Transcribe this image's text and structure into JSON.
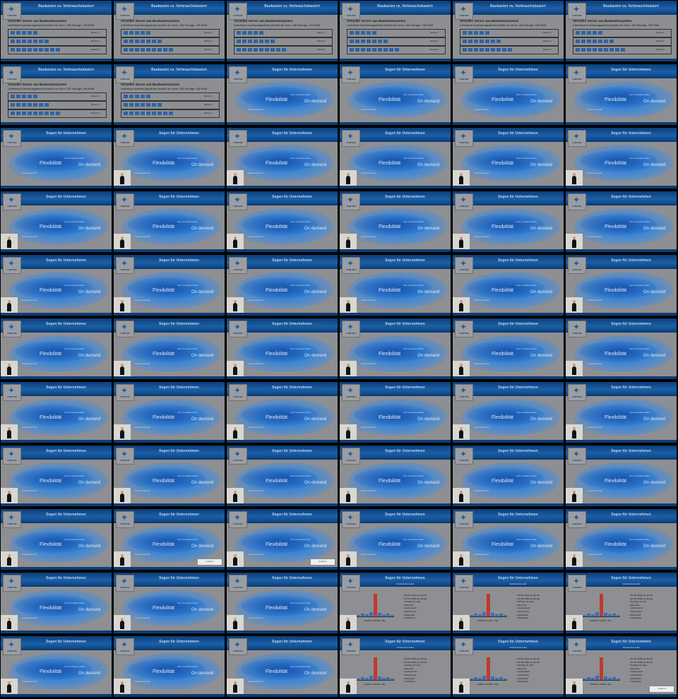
{
  "sheet": {
    "columns": 6,
    "rows": 11,
    "frame_count": 66
  },
  "slides": {
    "server": {
      "title": "Baukasten vs. Verbrauchsbasiert",
      "heading": "Virtueller Server aus Baukastensystem",
      "subheading": "Lieferbare Ausrüstungsstufen jeweils ein Kern, GB Storage, GB RAM",
      "server_labels": [
        "Server 1",
        "Server 2",
        "Server 3"
      ]
    },
    "cloud": {
      "title": "Segen für Unternehmen",
      "word_flex": "Flexibilität",
      "word_ondemand": "On demand",
      "word_small": "Kein Investitionsrisiko",
      "word_small2": "Kostenersparnis"
    },
    "chart": {
      "title": "Segen für Unternehmen",
      "subtitle": "Verbrauchsmodell",
      "chart_label": "Zeitlicher Verlauf / Tag",
      "bullets": [
        "50 Mio Mails pro Monat",
        "20 TB Traffic pro Monat",
        "Tanztag: für viele",
        "Elemente",
        "Lastrequests",
        "Abrechnung",
        "Datenbank",
        "Verwaltung"
      ]
    }
  },
  "logo": {
    "text": "FUNKTION"
  },
  "badge": {
    "text": "Qualifiziert"
  },
  "chart_data": {
    "type": "bar",
    "categories": [
      "1",
      "2",
      "3",
      "4",
      "5",
      "6",
      "7",
      "8",
      "9"
    ],
    "values": [
      2,
      4,
      3,
      6,
      30,
      5,
      3,
      4,
      2
    ]
  }
}
